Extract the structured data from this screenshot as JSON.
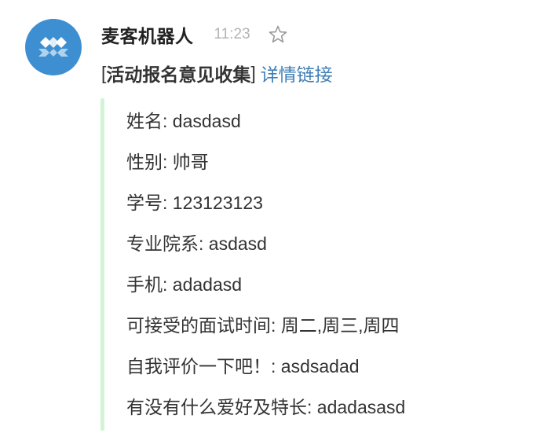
{
  "message": {
    "sender": "麦客机器人",
    "time": "11:23",
    "star_icon": "star-outline-icon",
    "avatar_icon": "mikecrm-logo-icon",
    "title": {
      "open_bracket": "[",
      "text": "活动报名意见收集",
      "close_bracket": "]",
      "link_label": "详情链接"
    },
    "fields": [
      {
        "label": "姓名",
        "value": "dasdasd"
      },
      {
        "label": "性别",
        "value": "帅哥"
      },
      {
        "label": "学号",
        "value": "123123123"
      },
      {
        "label": "专业院系",
        "value": "asdasd"
      },
      {
        "label": "手机",
        "value": "adadasd"
      },
      {
        "label": "可接受的面试时间",
        "value": "周二,周三,周四"
      },
      {
        "label": "自我评价一下吧！",
        "value": "asdsadad"
      },
      {
        "label": "有没有什么爱好及特长",
        "value": "adadasasd"
      }
    ]
  },
  "colors": {
    "avatar_bg": "#3d8fd1",
    "link": "#3f7fb6",
    "timestamp": "#b4b4b4",
    "quote_bar": "#d2f4d6"
  }
}
